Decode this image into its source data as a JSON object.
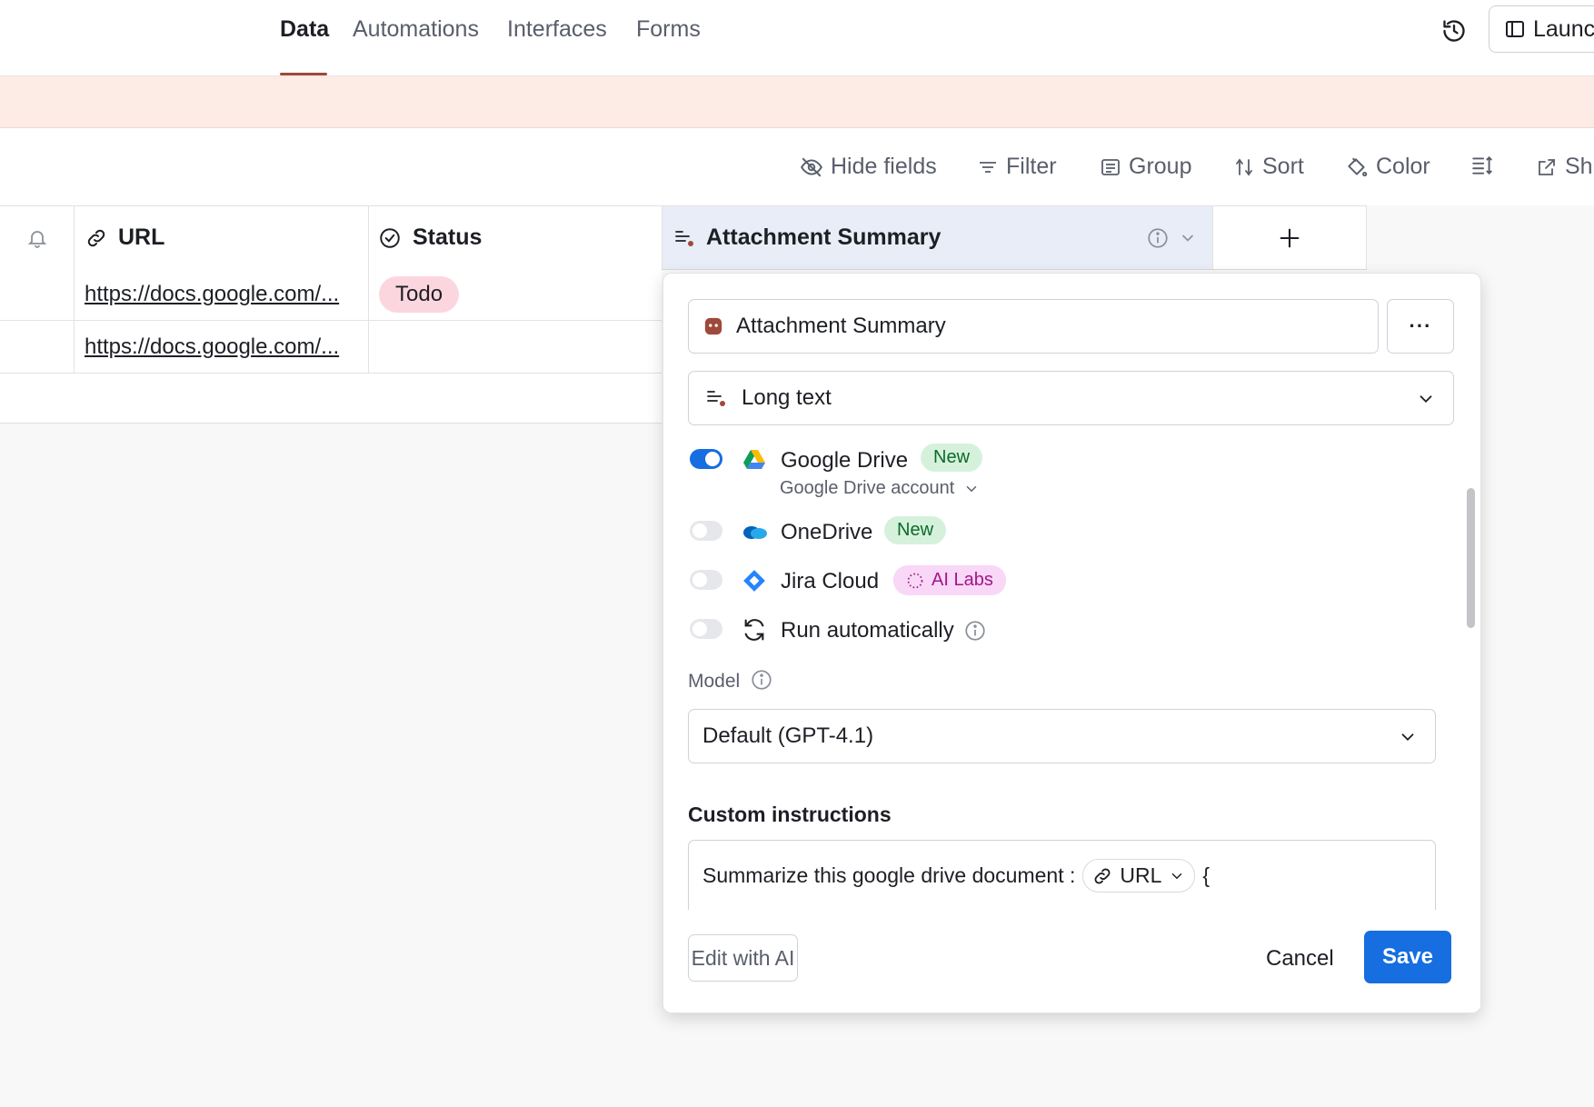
{
  "nav": {
    "tabs": [
      "Data",
      "Automations",
      "Interfaces",
      "Forms"
    ],
    "active_tab": "Data",
    "launch_label": "Launc"
  },
  "toolbar": {
    "hide_fields": "Hide fields",
    "filter": "Filter",
    "group": "Group",
    "sort": "Sort",
    "color": "Color",
    "share": "Sh"
  },
  "grid": {
    "columns": [
      "URL",
      "Status",
      "Attachment Summary"
    ],
    "rows": [
      {
        "url": "https://docs.google.com/...",
        "status": "Todo"
      },
      {
        "url": "https://docs.google.com/...",
        "status": ""
      }
    ]
  },
  "panel": {
    "field_name": "Attachment Summary",
    "more_label": "···",
    "field_type": "Long text",
    "sources": [
      {
        "label": "Google Drive",
        "badge": "New",
        "enabled": true,
        "sub_label": "Google Drive account"
      },
      {
        "label": "OneDrive",
        "badge": "New",
        "enabled": false
      },
      {
        "label": "Jira Cloud",
        "badge": "AI Labs",
        "enabled": false
      },
      {
        "label": "Run automatically",
        "enabled": false
      }
    ],
    "model_label": "Model",
    "model_value": "Default (GPT-4.1)",
    "custom_instructions_label": "Custom instructions",
    "instructions_text": "Summarize this google drive document :",
    "instructions_token": "URL",
    "instructions_tail": "{",
    "edit_ai_label": "Edit with AI",
    "cancel_label": "Cancel",
    "save_label": "Save"
  },
  "colors": {
    "accent": "#166ee1",
    "nav_underline": "#a0483a",
    "banner": "#fdebe5",
    "todo_pill": "#fcd6df",
    "field_icon": "#9e4a3a"
  }
}
